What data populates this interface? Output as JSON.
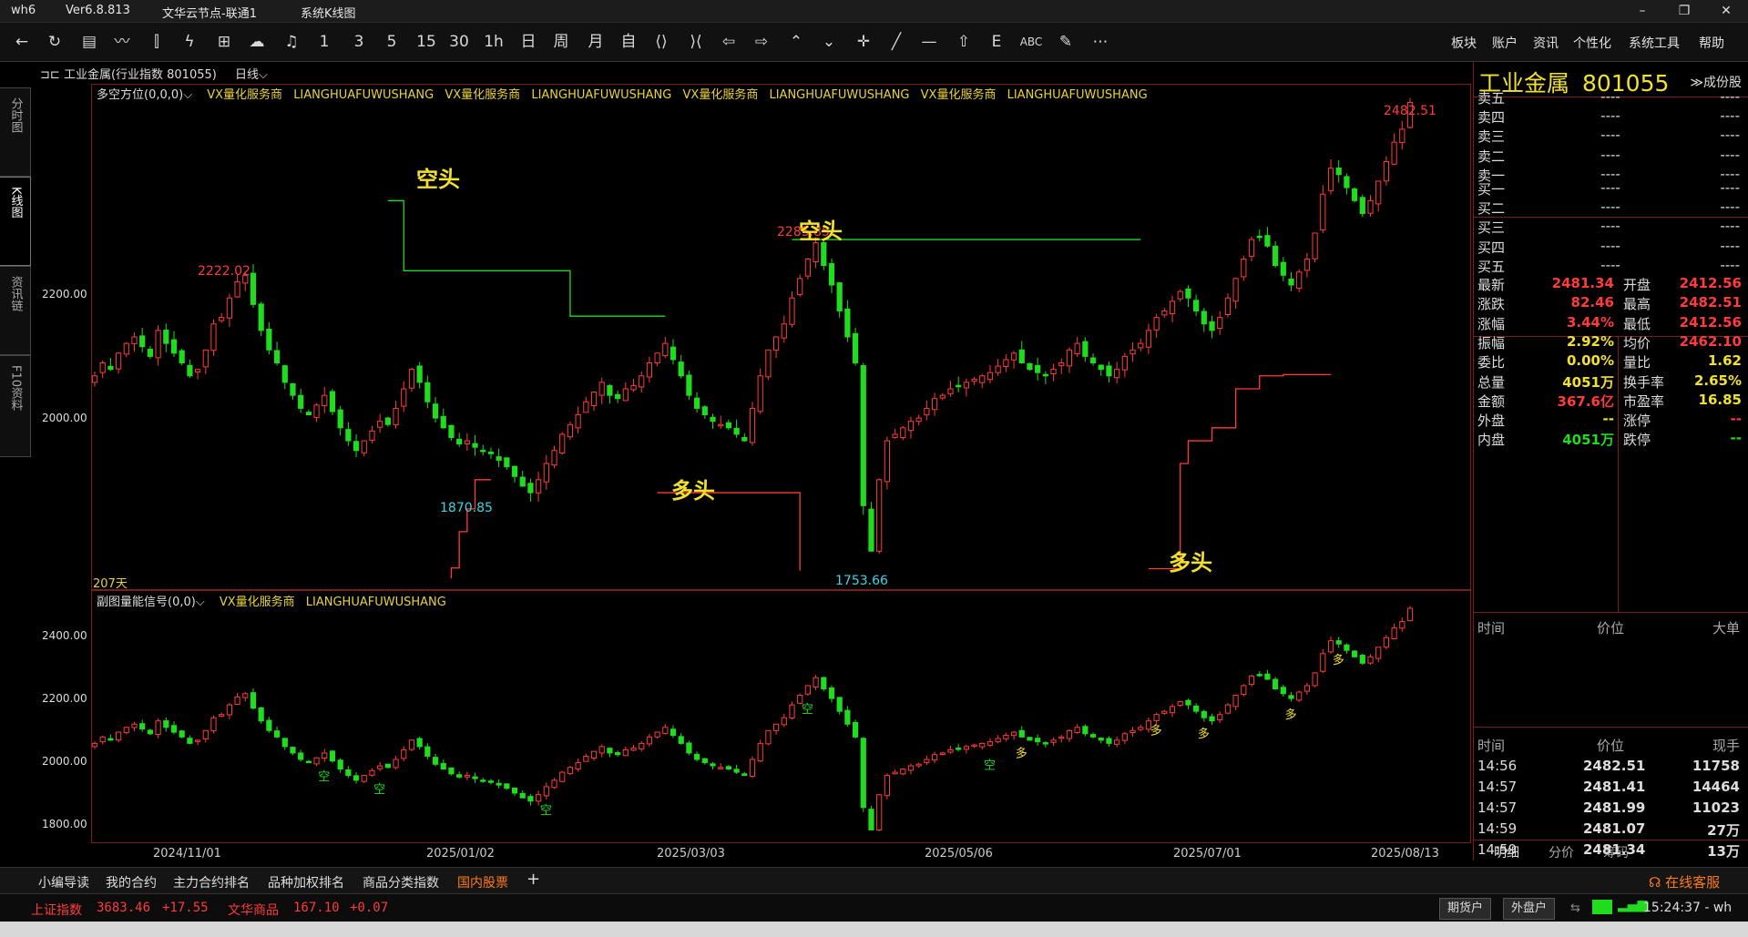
{
  "window": {
    "app": "wh6",
    "version": "Ver6.8.813",
    "server": "文华云节点-联通1",
    "module": "系统K线图",
    "controls": [
      "–",
      "❐",
      "✕"
    ]
  },
  "toolbar": {
    "period_buttons": [
      "1",
      "3",
      "5",
      "15",
      "30",
      "1h",
      "日",
      "周",
      "月",
      "自"
    ],
    "menus": [
      "板块",
      "账户",
      "资讯",
      "个性化",
      "系统工具",
      "帮助"
    ]
  },
  "left_tabs": [
    "分时图",
    "K线图",
    "资讯链",
    "F10资料"
  ],
  "chart": {
    "header_symbol": "工业金属(行业指数 801055)",
    "period": "日线",
    "main_indicator": "多空方位(0,0,0)",
    "sub_indicator": "副图量能信号(0,0)",
    "watermark_1": "VX量化服务商",
    "watermark_2": "LIANGHUAFUWUSHANG",
    "days_label": "207天",
    "main_y_ticks": [
      "2200.00",
      "2000.00"
    ],
    "sub_y_ticks": [
      "2400.00",
      "2200.00",
      "2000.00",
      "1800.00"
    ],
    "x_ticks": [
      "2024/11/01",
      "2025/01/02",
      "2025/03/03",
      "2025/05/06",
      "2025/07/01",
      "2025/08/13"
    ],
    "price_labels": {
      "high_left": "2222.02",
      "low_left": "1870.85",
      "high_mid": "2285.85",
      "low_mid": "1753.66",
      "high_right": "2482.51"
    },
    "signal_labels": {
      "short": "空头",
      "long": "多头"
    },
    "sub_marks": {
      "long": "多",
      "short": "空"
    }
  },
  "chart_data": {
    "type": "candlestick",
    "main_ylim": [
      1730,
      2510
    ],
    "sub_ylim": [
      1760,
      2470
    ],
    "closes": [
      2060,
      2080,
      2070,
      2095,
      2110,
      2120,
      2105,
      2090,
      2130,
      2110,
      2095,
      2080,
      2060,
      2070,
      2100,
      2140,
      2150,
      2180,
      2205,
      2215,
      2170,
      2130,
      2100,
      2080,
      2050,
      2030,
      2010,
      2000,
      2015,
      2030,
      2005,
      1980,
      1960,
      1945,
      1960,
      1975,
      1990,
      1985,
      2010,
      2040,
      2070,
      2050,
      2020,
      1995,
      1980,
      1965,
      1955,
      1960,
      1950,
      1945,
      1940,
      1930,
      1920,
      1905,
      1890,
      1880,
      1900,
      1925,
      1945,
      1970,
      1985,
      2000,
      2020,
      2035,
      2050,
      2030,
      2025,
      2040,
      2045,
      2060,
      2080,
      2095,
      2110,
      2085,
      2060,
      2030,
      2010,
      2000,
      1990,
      1985,
      1980,
      1970,
      1960,
      2010,
      2060,
      2100,
      2120,
      2140,
      2180,
      2210,
      2240,
      2265,
      2230,
      2200,
      2160,
      2120,
      2080,
      1860,
      1790,
      1900,
      1960,
      1970,
      1980,
      1990,
      1995,
      2010,
      2025,
      2030,
      2040,
      2045,
      2050,
      2055,
      2060,
      2065,
      2075,
      2085,
      2095,
      2080,
      2070,
      2065,
      2060,
      2070,
      2080,
      2100,
      2110,
      2090,
      2080,
      2070,
      2060,
      2070,
      2090,
      2100,
      2110,
      2130,
      2150,
      2160,
      2175,
      2190,
      2180,
      2160,
      2140,
      2130,
      2150,
      2180,
      2210,
      2240,
      2270,
      2275,
      2260,
      2230,
      2215,
      2200,
      2220,
      2240,
      2280,
      2340,
      2380,
      2370,
      2350,
      2330,
      2310,
      2330,
      2360,
      2390,
      2420,
      2440,
      2481.34
    ],
    "signals": [
      {
        "type": "空头",
        "date_index": 42,
        "level": 2334
      },
      {
        "type": "空头",
        "date_index": 91,
        "level": 2254
      },
      {
        "type": "多头",
        "date_index": 72,
        "level": 1898
      },
      {
        "type": "多头",
        "date_index": 159,
        "level": 1797
      }
    ],
    "extremes": {
      "2222.02": "2024/11",
      "1870.85": "2025/01",
      "2285.85": "2025/04",
      "1753.66": "2025/04",
      "2482.51": "2025/08/13"
    }
  },
  "quote": {
    "title": "工业金属",
    "code": "801055",
    "constituents_link": "≫成份股",
    "asks": [
      [
        "卖五",
        "----",
        "----"
      ],
      [
        "卖四",
        "----",
        "----"
      ],
      [
        "卖三",
        "----",
        "----"
      ],
      [
        "卖二",
        "----",
        "----"
      ],
      [
        "卖一",
        "----",
        "----"
      ]
    ],
    "bids": [
      [
        "买一",
        "----",
        "----"
      ],
      [
        "买二",
        "----",
        "----"
      ],
      [
        "买三",
        "----",
        "----"
      ],
      [
        "买四",
        "----",
        "----"
      ],
      [
        "买五",
        "----",
        "----"
      ]
    ],
    "stats_left": [
      [
        "最新",
        "2481.34",
        "red"
      ],
      [
        "涨跌",
        "82.46",
        "red"
      ],
      [
        "涨幅",
        "3.44%",
        "red"
      ],
      [
        "振幅",
        "2.92%",
        "yellow"
      ],
      [
        "委比",
        "0.00%",
        "yellow"
      ],
      [
        "总量",
        "4051万",
        "yellow"
      ],
      [
        "金额",
        "367.6亿",
        "red"
      ],
      [
        "外盘",
        "--",
        "yellow"
      ],
      [
        "内盘",
        "4051万",
        "green"
      ]
    ],
    "stats_right": [
      [
        "开盘",
        "2412.56",
        "red"
      ],
      [
        "最高",
        "2482.51",
        "red"
      ],
      [
        "最低",
        "2412.56",
        "red"
      ],
      [
        "均价",
        "2462.10",
        "red"
      ],
      [
        "量比",
        "1.62",
        "yellow"
      ],
      [
        "换手率",
        "2.65%",
        "yellow"
      ],
      [
        "市盈率",
        "16.85",
        "yellow"
      ],
      [
        "涨停",
        "--",
        "red"
      ],
      [
        "跌停",
        "--",
        "green"
      ]
    ],
    "ticks_header": [
      "时间",
      "价位",
      "大单"
    ],
    "trades_header": [
      "时间",
      "价位",
      "现手"
    ],
    "trades": [
      [
        "14:56",
        "2482.51",
        "11758"
      ],
      [
        "14:57",
        "2481.41",
        "14464"
      ],
      [
        "14:57",
        "2481.99",
        "11023"
      ],
      [
        "14:59",
        "2481.07",
        "27万"
      ],
      [
        "14:59",
        "2481.34",
        "13万"
      ]
    ],
    "panel_tabs": [
      "明细",
      "分价",
      "筹码"
    ]
  },
  "bottom_tabs": [
    "小编导读",
    "我的合约",
    "主力合约排名",
    "品种加权排名",
    "商品分类指数",
    "国内股票",
    "+"
  ],
  "status": {
    "sh_label": "上证指数",
    "sh_value": "3683.46",
    "sh_change": "+17.55",
    "wh_label": "文华商品",
    "wh_value": "167.10",
    "wh_change": "+0.07",
    "btn_futures": "期货户",
    "btn_fx": "外盘户",
    "time": "15:24:37 - wh",
    "online_service": "在线客服"
  },
  "colors": {
    "up": "#ff3b3b",
    "down": "#1fdc1f",
    "accent": "#f2e02e",
    "frame": "#7a1d1d"
  }
}
